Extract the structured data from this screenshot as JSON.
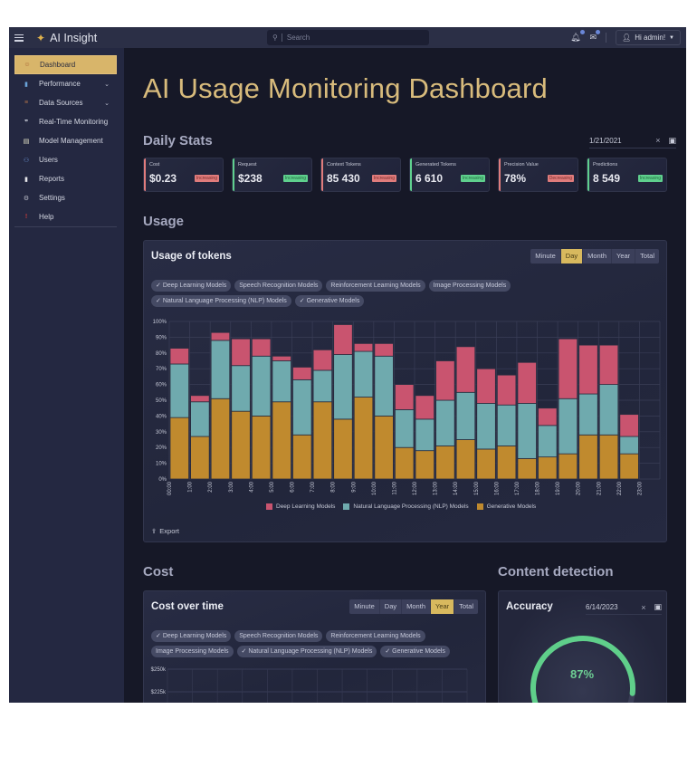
{
  "topbar": {
    "menu_icon": "hamburger-icon",
    "brand": "AI Insight",
    "brand_icon": "sparkles-icon",
    "search_placeholder": "Search",
    "user_label": "Hi admin!",
    "notifications_icon": "bell-icon",
    "messages_icon": "envelope-icon"
  },
  "sidebar": {
    "items": [
      {
        "label": "Dashboard",
        "icon": "dashboard-icon",
        "active": true
      },
      {
        "label": "Performance",
        "icon": "bar-chart-icon",
        "expandable": true
      },
      {
        "label": "Data Sources",
        "icon": "database-icon",
        "expandable": true
      },
      {
        "label": "Real-Time Monitoring",
        "icon": "quote-icon"
      },
      {
        "label": "Model Management",
        "icon": "document-edit-icon"
      },
      {
        "label": "Users",
        "icon": "users-icon"
      },
      {
        "label": "Reports",
        "icon": "clipboard-icon"
      },
      {
        "label": "Settings",
        "icon": "gear-icon"
      },
      {
        "label": "Help",
        "icon": "exclamation-icon"
      }
    ]
  },
  "page": {
    "title": "AI Usage Monitoring Dashboard"
  },
  "daily_stats": {
    "title": "Daily Stats",
    "date": "1/21/2021",
    "cards": [
      {
        "label": "Cost",
        "value": "$0.23",
        "badge": "Increasing",
        "tone": "bad"
      },
      {
        "label": "Request",
        "value": "$238",
        "badge": "Increasing",
        "tone": "good"
      },
      {
        "label": "Context Tokens",
        "value": "85 430",
        "badge": "Increasing",
        "tone": "bad"
      },
      {
        "label": "Generated Tokens",
        "value": "6 610",
        "badge": "Increasing",
        "tone": "good"
      },
      {
        "label": "Precision Value",
        "value": "78%",
        "badge": "Decreasing",
        "tone": "bad"
      },
      {
        "label": "Predictions",
        "value": "8 549",
        "badge": "Increasing",
        "tone": "good"
      }
    ],
    "colors": {
      "good": "#5fd08e",
      "bad": "#e07c7c"
    }
  },
  "usage": {
    "section_title": "Usage",
    "card_title": "Usage of tokens",
    "periods": [
      "Minute",
      "Day",
      "Month",
      "Year",
      "Total"
    ],
    "active_period": "Day",
    "filters": [
      {
        "label": "Deep Learning Models",
        "checked": true
      },
      {
        "label": "Speech Recognition Models",
        "checked": false
      },
      {
        "label": "Reinforcement Learning Models",
        "checked": false
      },
      {
        "label": "Image Processing Models",
        "checked": false
      },
      {
        "label": "Natural Language Processing (NLP) Models",
        "checked": true
      },
      {
        "label": "Generative Models",
        "checked": true
      }
    ],
    "export_label": "Export"
  },
  "chart_data": {
    "type": "bar",
    "stacked": true,
    "title": "Usage of tokens",
    "xlabel": "",
    "ylabel": "",
    "ylim": [
      0,
      100
    ],
    "y_ticks": [
      "0%",
      "10%",
      "20%",
      "30%",
      "40%",
      "50%",
      "60%",
      "70%",
      "80%",
      "90%",
      "100%"
    ],
    "categories": [
      "00:00",
      "1:00",
      "2:00",
      "3:00",
      "4:00",
      "5:00",
      "6:00",
      "7:00",
      "8:00",
      "9:00",
      "10:00",
      "11:00",
      "12:00",
      "13:00",
      "14:00",
      "15:00",
      "16:00",
      "17:00",
      "18:00",
      "19:00",
      "20:00",
      "21:00",
      "22:00",
      "23:00"
    ],
    "grid": true,
    "legend_position": "bottom",
    "series": [
      {
        "name": "Generative Models",
        "color": "#c08a2e",
        "values": [
          39,
          27,
          51,
          43,
          40,
          49,
          28,
          49,
          38,
          52,
          40,
          20,
          18,
          21,
          25,
          19,
          21,
          13,
          14,
          16,
          28,
          28,
          16,
          null
        ]
      },
      {
        "name": "Natural Language Processing (NLP) Models",
        "color": "#6faaae",
        "values": [
          34,
          22,
          37,
          29,
          38,
          26,
          35,
          20,
          41,
          29,
          38,
          24,
          20,
          29,
          30,
          29,
          26,
          35,
          20,
          35,
          26,
          32,
          11,
          null
        ]
      },
      {
        "name": "Deep Learning Models",
        "color": "#c9546f",
        "values": [
          10,
          4,
          5,
          17,
          11,
          3,
          8,
          13,
          19,
          5,
          8,
          16,
          15,
          25,
          29,
          22,
          19,
          26,
          11,
          38,
          31,
          25,
          14,
          null
        ]
      }
    ],
    "legend_order": [
      "Deep Learning Models",
      "Natural Language Processing (NLP) Models",
      "Generative Models"
    ]
  },
  "cost": {
    "section_title": "Cost",
    "card_title": "Cost over time",
    "periods": [
      "Minute",
      "Day",
      "Month",
      "Year",
      "Total"
    ],
    "active_period": "Year",
    "filters": [
      {
        "label": "Deep Learning Models",
        "checked": true
      },
      {
        "label": "Speech Recognition Models",
        "checked": false
      },
      {
        "label": "Reinforcement Learning Models",
        "checked": false
      },
      {
        "label": "Image Processing Models",
        "checked": false
      },
      {
        "label": "Natural Language Processing (NLP) Models",
        "checked": true
      },
      {
        "label": "Generative Models",
        "checked": true
      }
    ],
    "y_ticks_visible": [
      "$250k",
      "$225k"
    ]
  },
  "content_detection": {
    "section_title": "Content detection",
    "card_title": "Accuracy",
    "date": "6/14/2023",
    "accuracy_value": 87,
    "accuracy_label": "87%",
    "gauge_color": "#5fcf8a",
    "gauge_track_color": "#3b3f57"
  }
}
